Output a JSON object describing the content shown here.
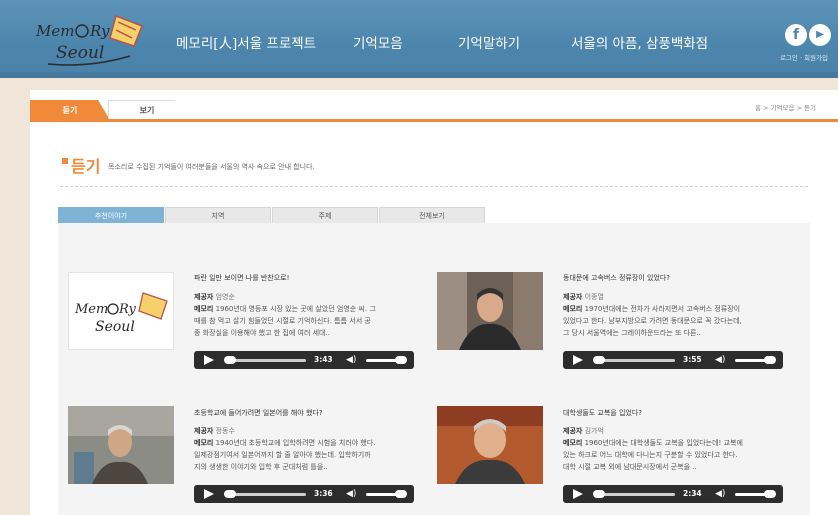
{
  "header": {
    "nav": [
      "메모리[人]서울 프로젝트",
      "기억모음",
      "기억말하기",
      "서울의 아픔, 삼풍백화점"
    ],
    "top_links": "로그인 · 회원가입",
    "sns": {
      "facebook": "f",
      "youtube": "▶"
    }
  },
  "page_tabs": {
    "listen": "듣기",
    "view": "보기"
  },
  "breadcrumb": "홈 > 기억모음 > 듣기",
  "page": {
    "title": "듣기",
    "description": "목소리로 수집된 기억들이 여러분들을 서울의 역사 속으로 안내 합니다."
  },
  "sub_tabs": [
    "추천이야기",
    "지역",
    "주제",
    "전체보기"
  ],
  "labels": {
    "provider": "제공자",
    "memory": "메모리"
  },
  "entries": [
    {
      "title": "파란 일만 보이면 나를 반찬으로!",
      "provider": "엄영순",
      "excerpt_lines": [
        "1960년대 영등포 시장 있는 곳에 살았던 엄영순 씨. 그",
        "때를 참 먹고 살기 힘들었던 시절로 기억하신다. 틈틈 서서 공",
        "중 화장실을 이용해야 했고 한 집에 여러 세대.."
      ],
      "time": "3:43",
      "thumb": "logo"
    },
    {
      "title": "동대문에 고속버스 정류장이 있었다?",
      "provider": "이종열",
      "excerpt_lines": [
        "1970년대에는 전차가 사라지면서 고속버스 정류장이",
        "있었다고 한다. 남부지방으로 가려면 동대문으로 꼭 갔다는데,",
        "그 당시 서울역에는 그레이하운드라는 또 다른.."
      ],
      "time": "3:55",
      "thumb": "man1"
    },
    {
      "title": "초등학교에 들어가려면 일본어를 해야 했다?",
      "provider": "정동수",
      "excerpt_lines": [
        "1940년대 초등학교에 입학하려면 시험을 치러야 했다.",
        "일제강점기여서 일본어까지 할 줄 알아야 했는데. 입학하기까",
        "지의 생생한 이야기와 입학 후 군대처럼 틀을.."
      ],
      "time": "3:36",
      "thumb": "man2"
    },
    {
      "title": "대학생들도 교복을 입었다?",
      "provider": "김가억",
      "excerpt_lines": [
        "1960년대에는 대학생들도 교복을 입었다는데! 교복에",
        "있는 하크로 어느 대학에 다니는지 구분할 수 있었다고 한다.",
        "대학 시절 교복 외에 남대문시장에서 군복을 .."
      ],
      "time": "2:34",
      "thumb": "man3"
    }
  ]
}
